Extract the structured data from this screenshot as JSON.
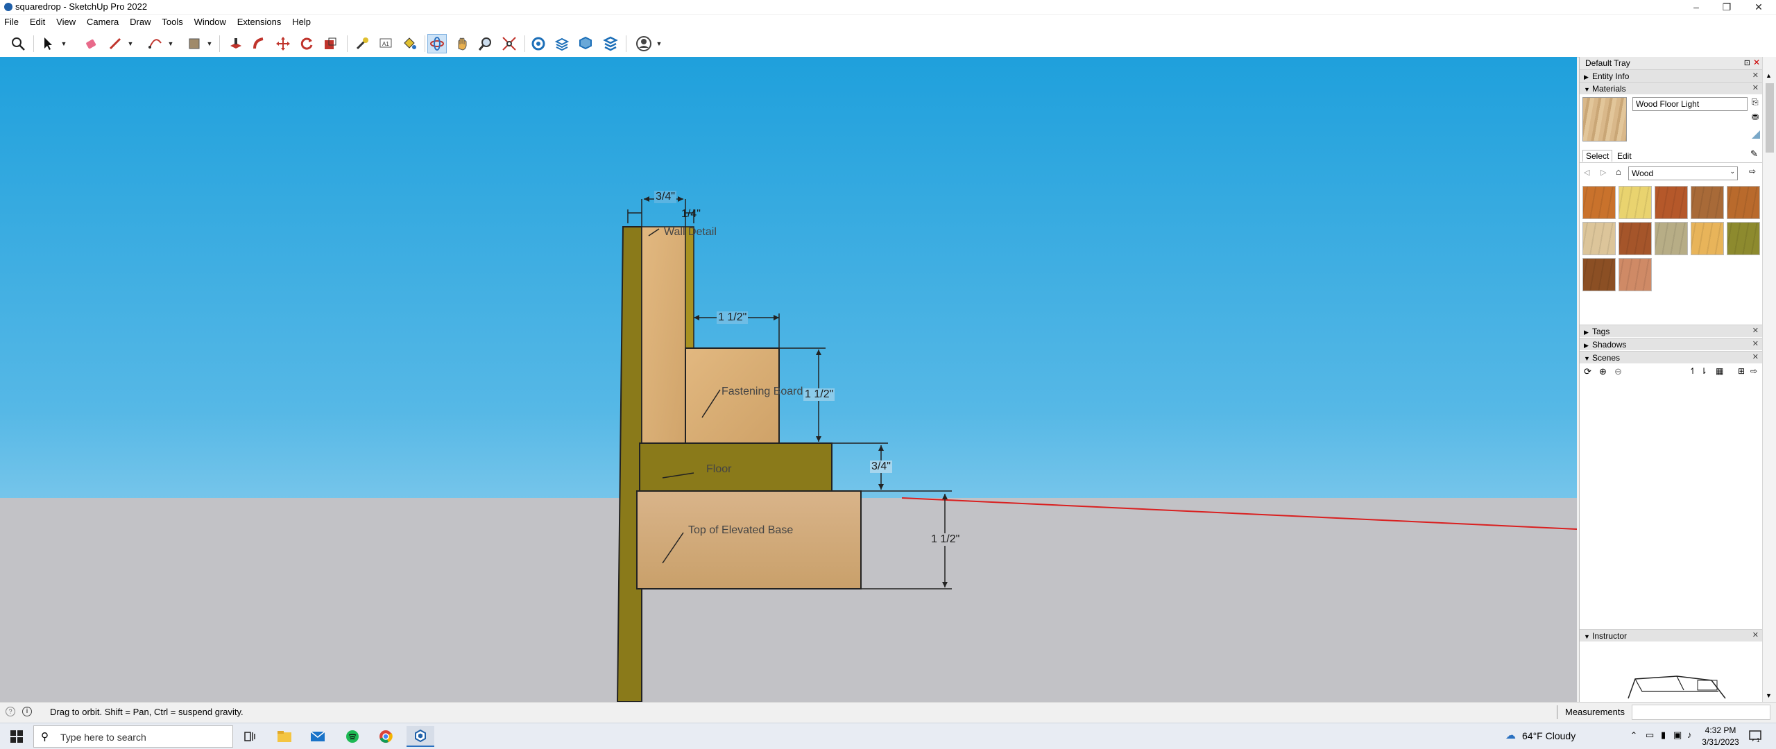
{
  "window": {
    "title": "squaredrop - SketchUp Pro 2022",
    "min": "–",
    "max": "❐",
    "close": "✕"
  },
  "menu": [
    "File",
    "Edit",
    "View",
    "Camera",
    "Draw",
    "Tools",
    "Window",
    "Extensions",
    "Help"
  ],
  "toolbar": {
    "icons": [
      "search-icon",
      "select-arrow-icon",
      "eraser-icon",
      "line-pencil-icon",
      "arc-icon",
      "shape-rect-icon",
      "push-pull-icon",
      "follow-me-icon",
      "move-icon",
      "rotate-icon",
      "scale-icon",
      "tape-measure-icon",
      "text-icon",
      "paint-bucket-icon",
      "orbit-icon",
      "pan-icon",
      "zoom-icon",
      "zoom-extents-icon",
      "warehouse-icon",
      "extension-warehouse-icon",
      "layout-icon",
      "extension-manager-icon",
      "profile-icon"
    ]
  },
  "model": {
    "dimensions": {
      "d1": "3/4\"",
      "d2": "1/4\"",
      "d3": "1 1/2\"",
      "d4": "1 1/2\"",
      "d5": "3/4\"",
      "d6": "1 1/2\""
    },
    "labels": {
      "wall": "Wall Detail",
      "fastening": "Fastening Board",
      "floor": "Floor",
      "base": "Top of Elevated Base"
    },
    "colors": {
      "wall_strip": "#8a7a1a",
      "wood_light": "#dcb27a",
      "floor_board": "#8a7a1a",
      "axis_red": "#d92020"
    }
  },
  "tray": {
    "title": "Default Tray",
    "panels": {
      "entity_info": "Entity Info",
      "materials": "Materials",
      "tags": "Tags",
      "shadows": "Shadows",
      "scenes": "Scenes",
      "instructor": "Instructor"
    },
    "material_name": "Wood Floor Light",
    "tab_select": "Select",
    "tab_edit": "Edit",
    "library": "Wood",
    "swatches": [
      "#c9722c",
      "#e9d36f",
      "#b5582a",
      "#a86a38",
      "#b96a2c",
      "#dcc59a",
      "#a5552a",
      "#b7ad86",
      "#e8b45a",
      "#8d8a2e",
      "#8b4f24",
      "#cf8a66"
    ]
  },
  "status": {
    "hint": "Drag to orbit. Shift = Pan, Ctrl = suspend gravity.",
    "measurements": "Measurements"
  },
  "taskbar": {
    "search_placeholder": "Type here to search",
    "weather": "64°F  Cloudy",
    "time": "4:32 PM",
    "date": "3/31/2023"
  }
}
